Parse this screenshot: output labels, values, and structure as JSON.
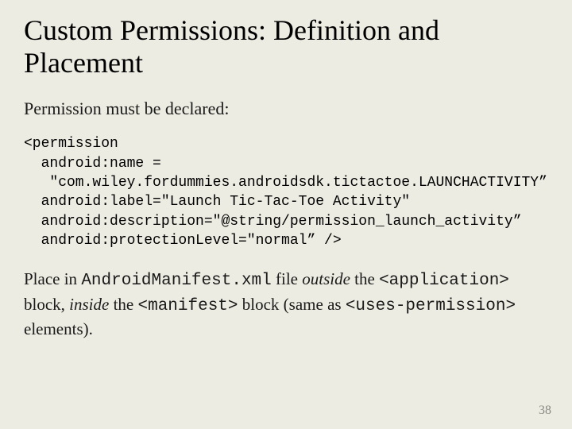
{
  "title": "Custom Permissions: Definition and Placement",
  "subhead": "Permission must be declared:",
  "code": {
    "l1": "<permission",
    "l2": "  android:name =",
    "l3": "   \"com.wiley.fordummies.androidsdk.tictactoe.LAUNCHACTIVITY”",
    "l4": "  android:label=\"Launch Tic-Tac-Toe Activity\"",
    "l5": "  android:description=\"@string/permission_launch_activity”",
    "l6": "  android:protectionLevel=\"normal” />"
  },
  "body": {
    "t1": "Place in ",
    "m1": "AndroidManifest.xml",
    "t2": " file ",
    "i1": "outside",
    "t3": " the ",
    "m2": "<application>",
    "t4": " block, ",
    "i2": "inside",
    "t5": " the ",
    "m3": "<manifest>",
    "t6": " block (same as ",
    "m4": "<uses-permission>",
    "t7": " elements)."
  },
  "pagenum": "38"
}
